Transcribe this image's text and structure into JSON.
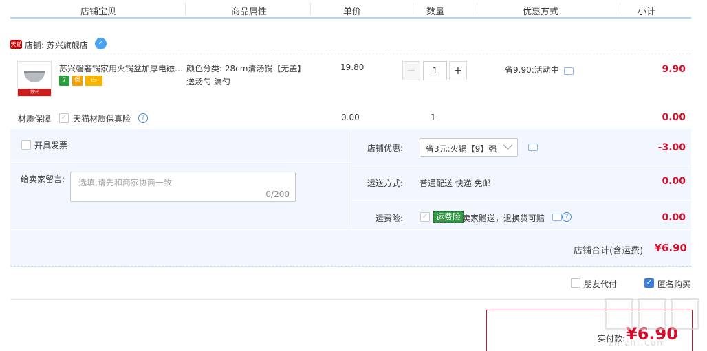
{
  "header": {
    "col_shop": "店铺宝贝",
    "col_attr": "商品属性",
    "col_price": "单价",
    "col_qty": "数量",
    "col_promo": "优惠方式",
    "col_subtotal": "小计"
  },
  "shop": {
    "badge": "天猫",
    "name": "店铺: 苏兴旗舰店"
  },
  "item": {
    "title": "苏兴磐奢锅家用火锅盆加厚电磁…",
    "attr_line1": "颜色分类: 28cm清汤锅【无盖】",
    "attr_line2": "送汤勺 漏勺",
    "price": "19.80",
    "qty": "1",
    "promo": "省9.90:活动中",
    "subtotal": "9.90",
    "thumb_text": "苏兴"
  },
  "insurance": {
    "label": "材质保障",
    "option": "天猫材质保真险",
    "price": "0.00",
    "qty": "1",
    "subtotal": "0.00"
  },
  "order": {
    "invoice_label": "开具发票",
    "memo_label": "给卖家留言:",
    "memo_placeholder": "选填,请先和商家协商一致",
    "memo_count": "0/200",
    "shop_discount_label": "店铺优惠:",
    "shop_discount_value": "省3元:火锅【9】强",
    "shop_discount_amount": "-3.00",
    "shipping_label": "运送方式:",
    "shipping_value": "普通配送 快递 免邮",
    "shipping_amount": "0.00",
    "freight_ins_label": "运费险:",
    "freight_ins_tag": "运费险",
    "freight_ins_desc": "卖家赠送，退换货可赔",
    "freight_ins_amount": "0.00",
    "shop_total_label": "店铺合计(含运费)",
    "shop_total_value": "¥6.90"
  },
  "options": {
    "friend_pay": "朋友代付",
    "anonymous": "匿名购买"
  },
  "payment": {
    "label": "实付款:",
    "amount": "¥6.90"
  },
  "watermark": {
    "text": "zhizhi.com"
  },
  "colors": {
    "accent_blue": "#b2d1ff",
    "price_red": "#d40f2c",
    "panel_bg": "#f2f7ff",
    "tmall_red": "#d40000"
  },
  "icons": {
    "chat": "chat-bubble-icon",
    "help": "question-circle-icon",
    "wangwang": "wangwang-icon",
    "chevron": "chevron-down-icon"
  }
}
